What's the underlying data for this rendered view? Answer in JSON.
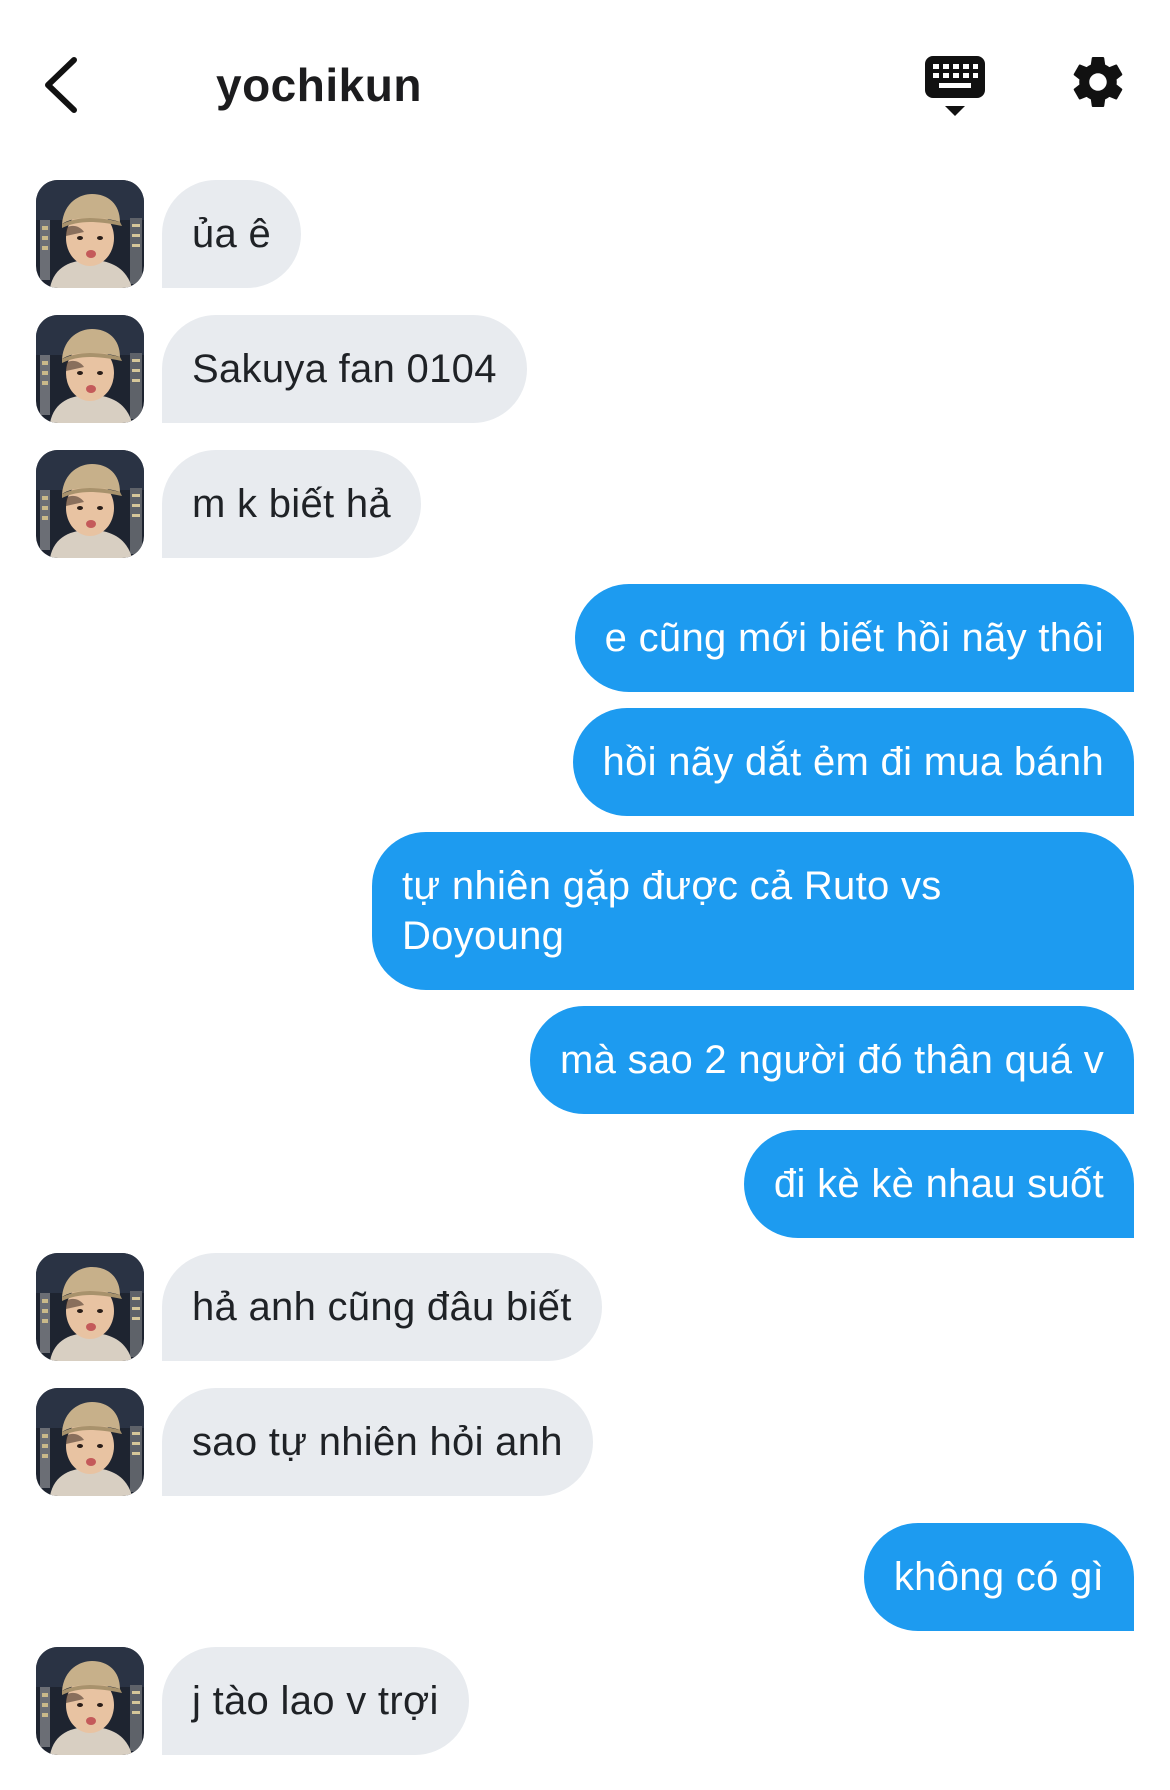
{
  "header": {
    "title": "yochikun",
    "back_icon": "chevron-left-icon",
    "keyboard_icon": "keyboard-icon",
    "settings_icon": "gear-icon"
  },
  "colors": {
    "outgoing_bubble": "#1d9bf0",
    "incoming_bubble": "#e8ebef",
    "text_dark": "#1c1c1e"
  },
  "messages": [
    {
      "from": "them",
      "text": "ủa ê"
    },
    {
      "from": "them",
      "text": "Sakuya fan 0104"
    },
    {
      "from": "them",
      "text": "m k biết hả"
    },
    {
      "from": "me",
      "text": "e cũng mới biết hồi nãy thôi"
    },
    {
      "from": "me",
      "text": "hồi nãy dắt ẻm đi mua bánh"
    },
    {
      "from": "me",
      "text": "tự nhiên gặp được cả Ruto vs Doyoung"
    },
    {
      "from": "me",
      "text": "mà sao 2 người đó thân quá v"
    },
    {
      "from": "me",
      "text": "đi kè kè nhau suốt"
    },
    {
      "from": "them",
      "text": "hả anh cũng đâu biết"
    },
    {
      "from": "them",
      "text": "sao tự nhiên hỏi anh"
    },
    {
      "from": "me",
      "text": "không có gì"
    },
    {
      "from": "them",
      "text": "j tào lao v trợi"
    }
  ]
}
